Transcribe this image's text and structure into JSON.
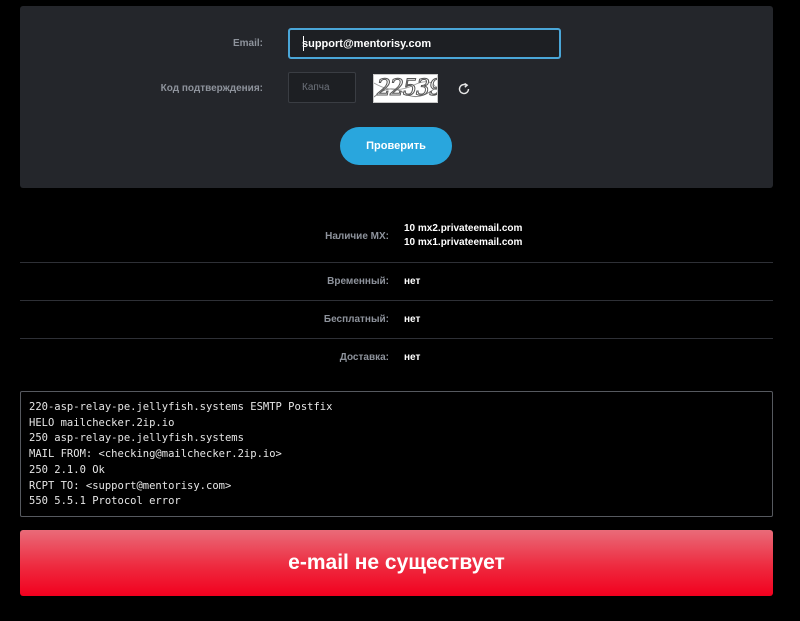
{
  "form": {
    "email_label": "Email:",
    "email_value": "support@mentorisy.com",
    "code_label": "Код подтверждения:",
    "captcha_placeholder": "Капча",
    "captcha_image_text": "22539",
    "check_button": "Проверить"
  },
  "results": [
    {
      "label": "Наличие MX:",
      "values": [
        "10 mx2.privateemail.com",
        "10 mx1.privateemail.com"
      ]
    },
    {
      "label": "Временный:",
      "values": [
        "нет"
      ]
    },
    {
      "label": "Бесплатный:",
      "values": [
        "нет"
      ]
    },
    {
      "label": "Доставка:",
      "values": [
        "нет"
      ]
    }
  ],
  "log": [
    "220-asp-relay-pe.jellyfish.systems ESMTP Postfix",
    "HELO mailchecker.2ip.io",
    "250 asp-relay-pe.jellyfish.systems",
    "MAIL FROM: <checking@mailchecker.2ip.io>",
    "250 2.1.0 Ok",
    "RCPT TO: <support@mentorisy.com>",
    "550 5.5.1 Protocol error"
  ],
  "verdict": "e-mail не существует",
  "colors": {
    "accent": "#29a6dd",
    "panel": "#24262b",
    "error": "#f2001e"
  },
  "icons": {
    "refresh": "refresh-icon"
  }
}
